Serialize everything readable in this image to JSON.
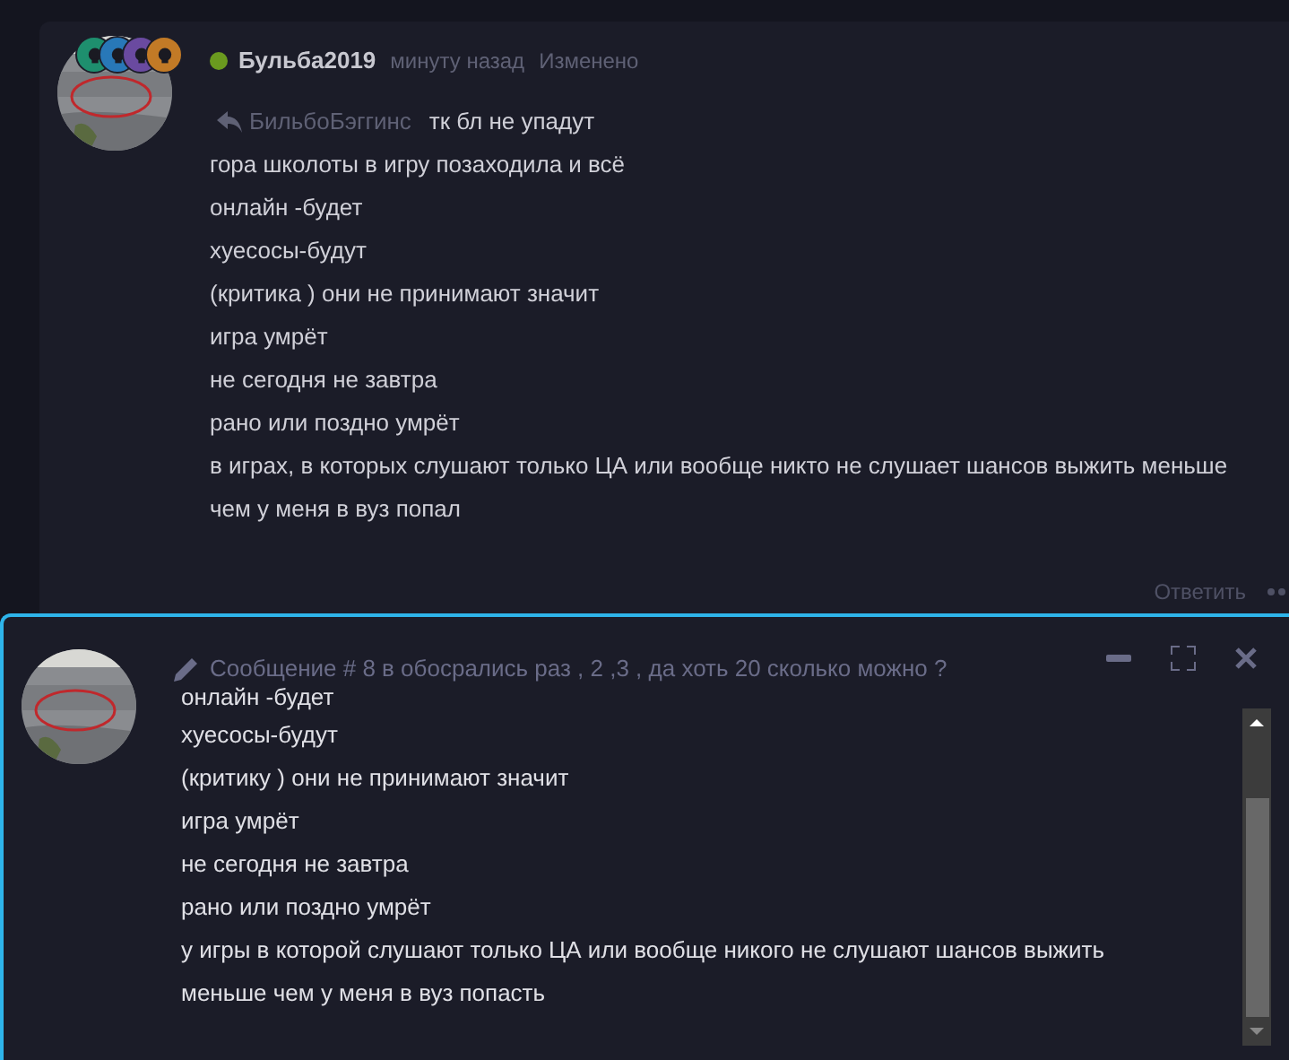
{
  "post": {
    "author": "Бульба2019",
    "online": true,
    "time": "минуту назад",
    "edited": "Изменено",
    "reply_to": "БильбоБэггинс",
    "quote": "тк бл не упадут",
    "badges": [
      {
        "color": "#1e8f6e"
      },
      {
        "color": "#2878b8"
      },
      {
        "color": "#6a4aa0"
      },
      {
        "color": "#c27a26"
      }
    ],
    "lines": [
      "гора школоты в игру позаходила и всё",
      "онлайн -будет",
      "хуесосы-будут",
      "(критика ) они не принимают значит",
      "игра умрёт",
      "не сегодня не завтра",
      "рано или поздно умрёт",
      "в играх, в которых слушают только ЦА или вообще никто не слушает шансов выжить меньше",
      "чем у меня в вуз попал"
    ],
    "reply_button": "Ответить"
  },
  "editor": {
    "title": "Сообщение # 8 в обосрались раз , 2 ,3 , да хоть 20 сколько можно ?",
    "lines": [
      "онлайн -будет",
      "хуесосы-будут",
      "(критику ) они не принимают значит",
      "игра умрёт",
      "не сегодня не завтра",
      "рано или поздно умрёт",
      "у игры в которой слушают только ЦА или вообще никого не слушают шансов выжить",
      "меньше чем у меня в вуз попасть"
    ]
  }
}
